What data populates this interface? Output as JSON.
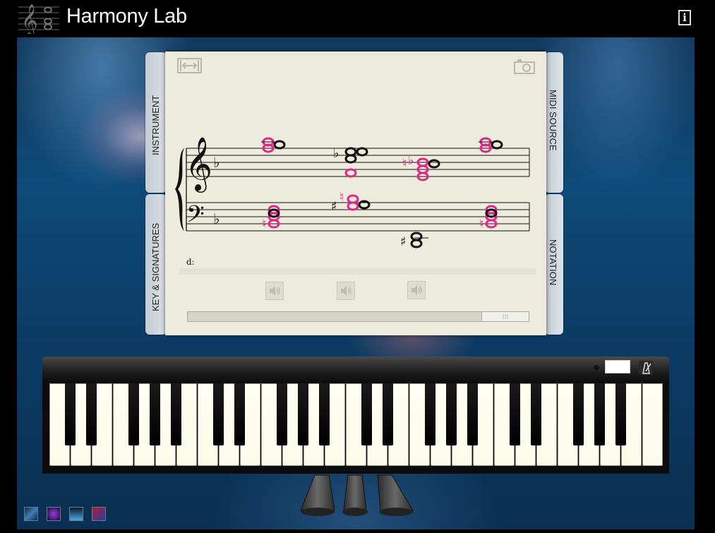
{
  "header": {
    "title": "Harmony Lab",
    "info_label": "i"
  },
  "tabs": {
    "instrument": "INSTRUMENT",
    "key_signatures": "KEY & SIGNATURES",
    "midi_source": "MIDI SOURCE",
    "notation": "NOTATION"
  },
  "score": {
    "analysis_key": "d:",
    "key_signature": "1 flat",
    "chords": [
      {
        "treble": [
          "F5 (magenta)",
          "G5"
        ],
        "bass": [
          "B♮2 (magenta)",
          "D3",
          "F3"
        ]
      },
      {
        "treble": [
          "B♭4 (magenta)",
          "C♭5",
          "E♭5",
          "F5"
        ],
        "bass": [
          "C♯3",
          "F♮3 (magenta)",
          "A3"
        ]
      },
      {
        "treble": [
          "A♭4",
          "C♭5",
          "E♭5",
          "F5"
        ],
        "bass": [
          "C♯2",
          "E2"
        ]
      },
      {
        "treble": [
          "F5 (magenta)",
          "G5"
        ],
        "bass": [
          "B♮2 (magenta)",
          "D3",
          "F3"
        ]
      }
    ]
  },
  "keyboard": {
    "tempo_value": "",
    "white_key_count": 29
  },
  "icons": {
    "fit": "fit-width-icon",
    "camera": "camera-icon",
    "speaker": "speaker-icon",
    "metronome": "metronome-icon",
    "info": "info-icon"
  },
  "colors": {
    "highlight_note": "#e0288c",
    "paper": "#ecebdc",
    "stage_blue": "#0e4a78"
  }
}
